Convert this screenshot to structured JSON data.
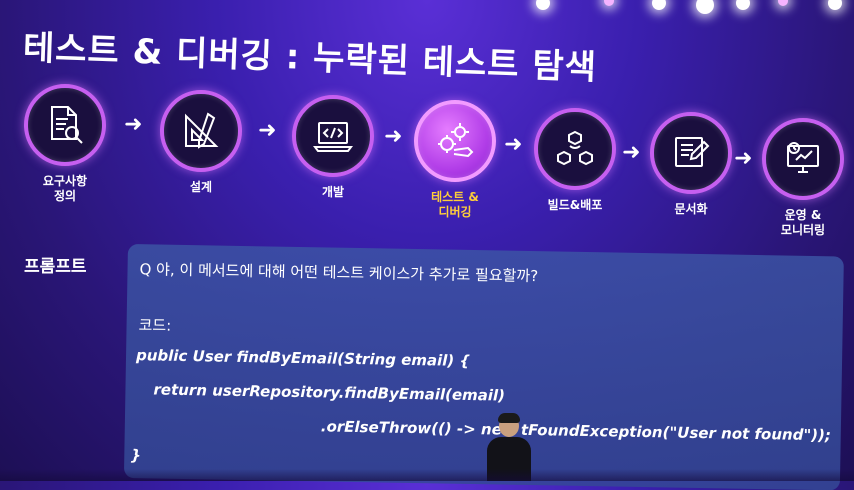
{
  "slide": {
    "title": "테스트 & 디버깅 : 누락된 테스트 탐색",
    "steps": [
      {
        "label": "요구사항\n정의",
        "icon": "document-search-icon",
        "active": false
      },
      {
        "label": "설계",
        "icon": "ruler-pencil-icon",
        "active": false
      },
      {
        "label": "개발",
        "icon": "laptop-code-icon",
        "active": false
      },
      {
        "label": "테스트 &\n디버깅",
        "icon": "gear-wrench-icon",
        "active": true
      },
      {
        "label": "빌드&배포",
        "icon": "cubes-deploy-icon",
        "active": false
      },
      {
        "label": "문서화",
        "icon": "document-pen-icon",
        "active": false
      },
      {
        "label": "운영 &\n모니터링",
        "icon": "monitor-gauge-icon",
        "active": false
      }
    ],
    "prompt_label": "프롬프트",
    "prompt": {
      "question": "Q 야, 이 메서드에 대해 어떤 테스트 케이스가 추가로 필요할까?",
      "code_label": "코드:",
      "code_lines": [
        "public User findByEmail(String email) {",
        "return userRepository.findByEmail(email)",
        ".orElseThrow(() -> new  tFoundException(\"User not found\"));",
        "}"
      ]
    }
  },
  "colors": {
    "background": "#3a1fae",
    "circle_border": "#c65ff0",
    "active_label": "#ffcf3a",
    "panel": "#3c55a5"
  }
}
